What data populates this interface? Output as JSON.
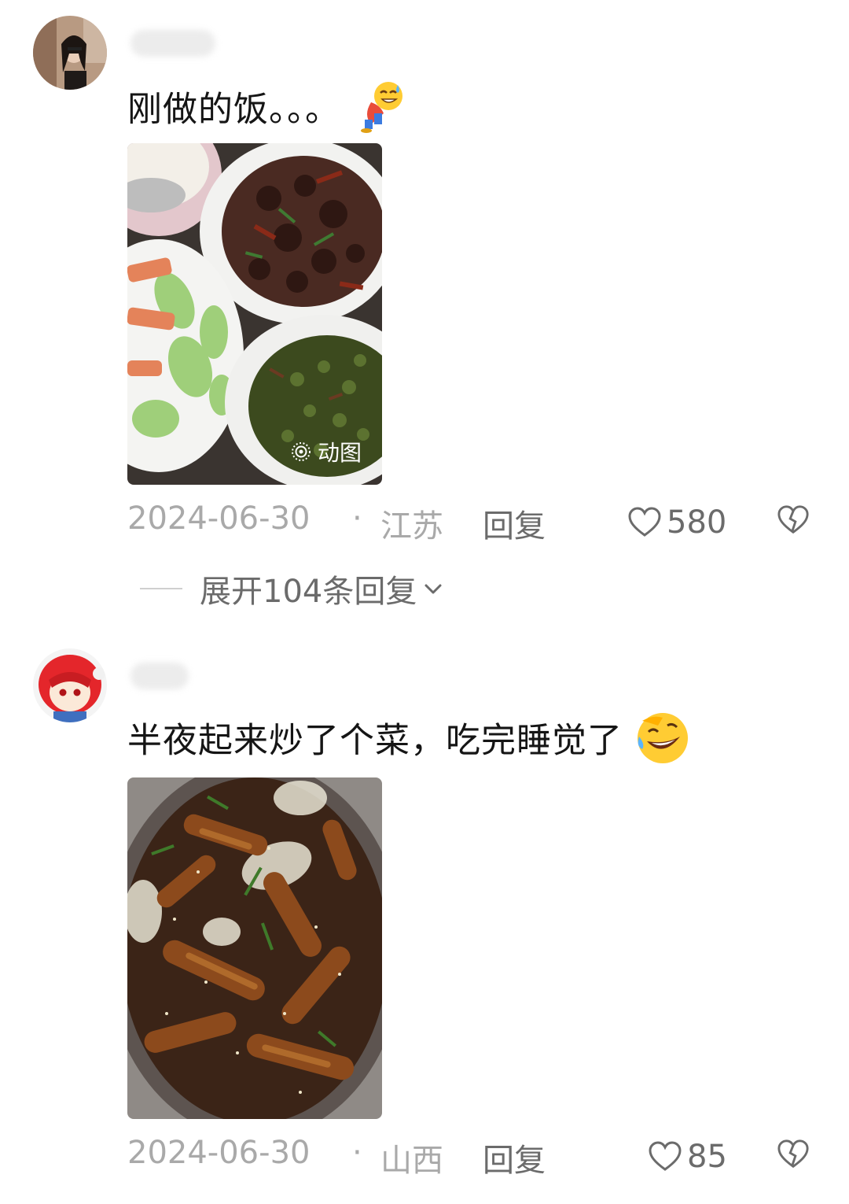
{
  "comments": [
    {
      "text": "刚做的饭。。。",
      "emoji": "sweat-smile-bowing-emoji",
      "photo_badge": "动图",
      "date": "2024-06-30",
      "separator": "·",
      "location": "江苏",
      "reply_label": "回复",
      "likes": "580",
      "expand_label": "展开104条回复"
    },
    {
      "text": "半夜起来炒了个菜，吃完睡觉了",
      "emoji": "rolling-laughing-emoji",
      "date": "2024-06-30",
      "separator": "·",
      "location": "山西",
      "reply_label": "回复",
      "likes": "85"
    }
  ],
  "icons": {
    "like": "heart-outline-icon",
    "dislike": "broken-heart-icon",
    "expand": "chevron-down-icon",
    "badge": "live-photo-icon"
  },
  "colors": {
    "text": "#151515",
    "meta": "#a9a9a9",
    "action": "#6b6b6b"
  }
}
